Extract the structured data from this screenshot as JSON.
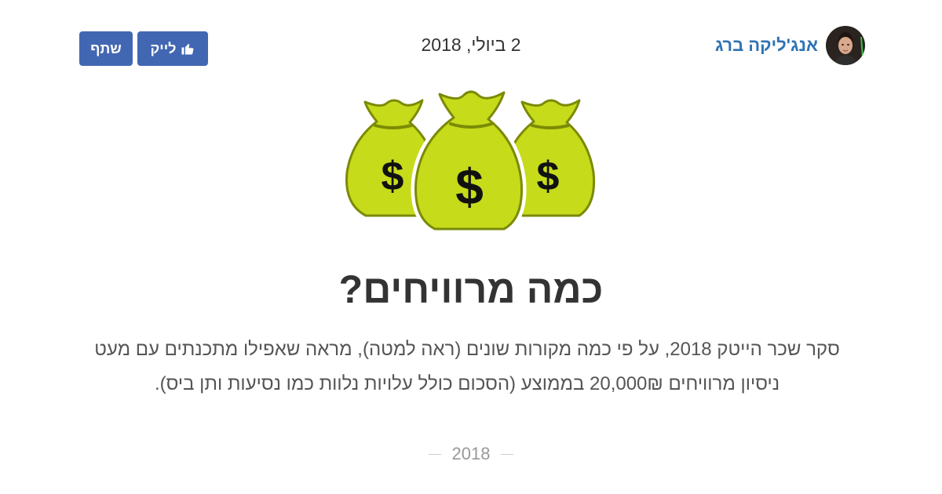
{
  "header": {
    "author_name": "אנג'ליקה ברג",
    "date": "2 ביולי, 2018",
    "like_label": "לייק",
    "share_label": "שתף"
  },
  "article": {
    "title": "כמה מרוויחים?",
    "description": "סקר שכר הייטק 2018, על פי כמה מקורות שונים (ראה למטה), מראה שאפילו מתכנתים עם מעט ניסיון מרוויחים 20,000₪ בממוצע (הסכום כולל עלויות נלוות כמו נסיעות ותן ביס).",
    "footer_year": "2018"
  },
  "illustration": {
    "icon": "money-bags-icon",
    "bag_symbol": "$",
    "bag_color": "#c6db1a",
    "outline_color": "#7b8a06"
  },
  "colors": {
    "facebook_blue": "#4267b2",
    "author_blue": "#2f73b3"
  }
}
